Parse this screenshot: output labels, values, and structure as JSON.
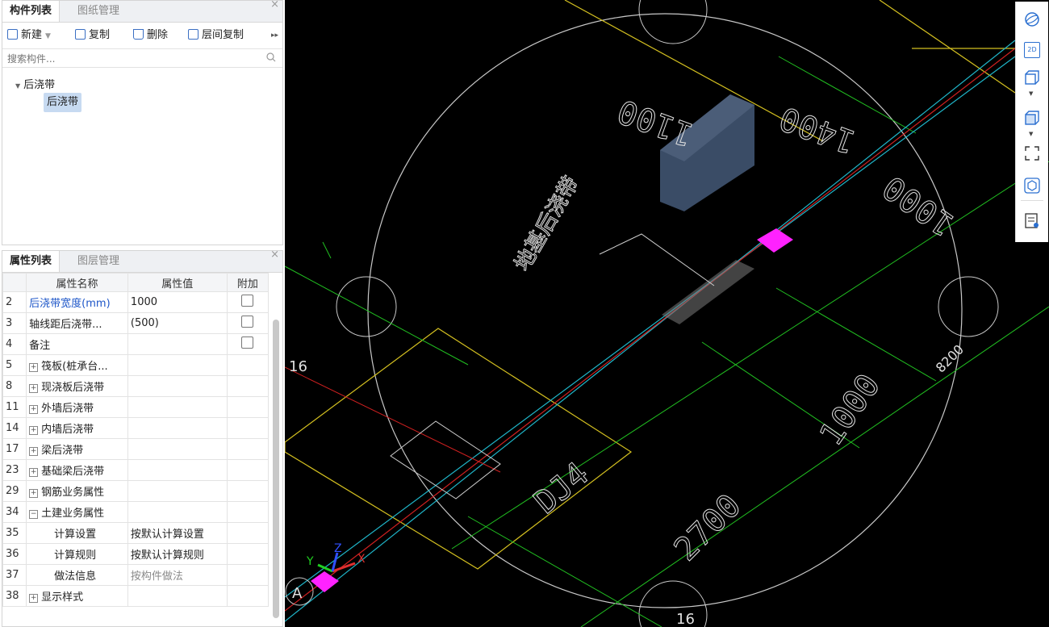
{
  "component_panel": {
    "tabs": [
      "构件列表",
      "图纸管理"
    ],
    "toolbar": {
      "new": "新建",
      "copy": "复制",
      "delete": "删除",
      "floor_copy": "层间复制"
    },
    "search_placeholder": "搜索构件...",
    "tree": {
      "group": "后浇带",
      "item": "后浇带"
    }
  },
  "property_panel": {
    "tabs": [
      "属性列表",
      "图层管理"
    ],
    "headers": [
      "属性名称",
      "属性值",
      "附加"
    ],
    "rows": [
      {
        "num": "2",
        "name": "后浇带宽度(mm)",
        "value": "1000"
      },
      {
        "num": "3",
        "name": "轴线距后浇带...",
        "value": "(500)"
      },
      {
        "num": "4",
        "name": "备注",
        "value": ""
      },
      {
        "num": "5",
        "name": "筏板(桩承台...",
        "value": ""
      },
      {
        "num": "8",
        "name": "现浇板后浇带",
        "value": ""
      },
      {
        "num": "11",
        "name": "外墙后浇带",
        "value": ""
      },
      {
        "num": "14",
        "name": "内墙后浇带",
        "value": ""
      },
      {
        "num": "17",
        "name": "梁后浇带",
        "value": ""
      },
      {
        "num": "23",
        "name": "基础梁后浇带",
        "value": ""
      },
      {
        "num": "29",
        "name": "钢筋业务属性",
        "value": ""
      },
      {
        "num": "34",
        "name": "土建业务属性",
        "value": ""
      },
      {
        "num": "35",
        "name": "计算设置",
        "value": "按默认计算设置"
      },
      {
        "num": "36",
        "name": "计算规则",
        "value": "按默认计算规则"
      },
      {
        "num": "37",
        "name": "做法信息",
        "value": "按构件做法"
      },
      {
        "num": "38",
        "name": "显示样式",
        "value": ""
      }
    ]
  },
  "canvas": {
    "labels": {
      "d1": "1100",
      "d2": "1400",
      "d3": "1000",
      "d4": "8200",
      "d5": "1000",
      "d6": "2700",
      "dj": "DJ4",
      "note": "地基后浇带",
      "axis16a": "16",
      "axis16b": "16",
      "axisA": "A",
      "x": "X",
      "y": "Y",
      "z": "Z"
    }
  },
  "right_toolbar": {
    "view2d": "2D"
  }
}
